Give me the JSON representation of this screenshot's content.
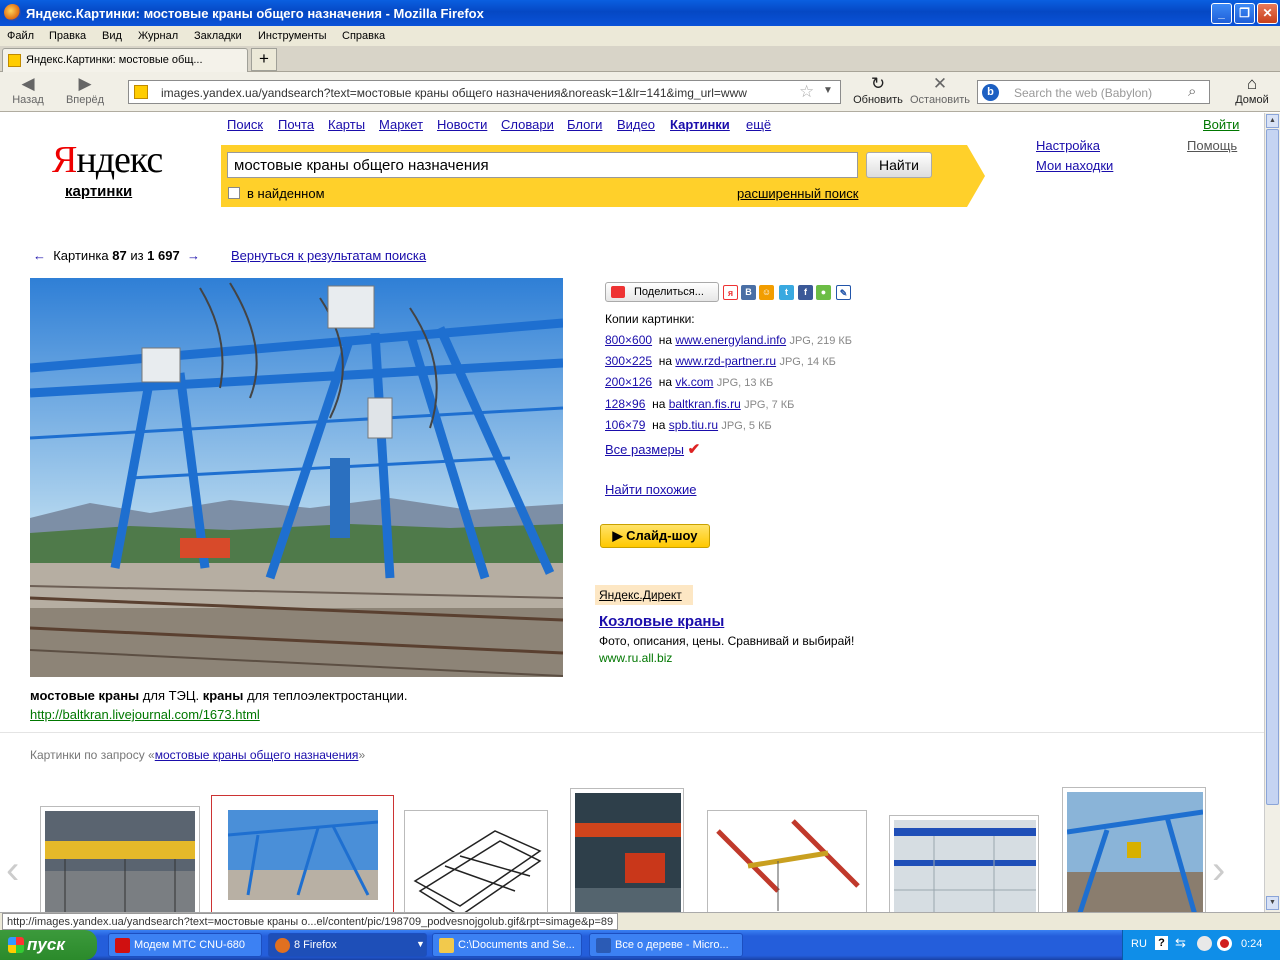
{
  "window": {
    "title": "Яндекс.Картинки: мостовые краны общего назначения - Mozilla Firefox",
    "min_icon": "minimize-icon",
    "max_icon": "maximize-icon",
    "close_icon": "close-icon"
  },
  "menu": [
    "Файл",
    "Правка",
    "Вид",
    "Журнал",
    "Закладки",
    "Инструменты",
    "Справка"
  ],
  "tab": {
    "label": "Яндекс.Картинки: мостовые общ...",
    "new_tab": "+"
  },
  "nav": {
    "back": "Назад",
    "forward": "Вперёд",
    "url": "images.yandex.ua/yandsearch?text=мостовые краны общего назначения&noreask=1&lr=141&img_url=www",
    "reload": "Обновить",
    "stop": "Остановить",
    "search_placeholder": "Search the web (Babylon)",
    "home": "Домой"
  },
  "page": {
    "services": [
      "Поиск",
      "Почта",
      "Карты",
      "Маркет",
      "Новости",
      "Словари",
      "Блоги",
      "Видео",
      "Картинки",
      "ещё"
    ],
    "login": "Войти",
    "settings": "Настройка",
    "help": "Помощь",
    "my_finds": "Мои находки",
    "logo_text": "Яндекс",
    "logo_sub": "картинки",
    "search": {
      "query": "мостовые краны общего назначения",
      "button": "Найти",
      "in_found": "в найденном",
      "advanced": "расширенный поиск"
    },
    "pager": {
      "arrow_left": "←",
      "prefix": "Картинка",
      "current": "87",
      "of": "из",
      "total": "1 697",
      "arrow_right": "→"
    },
    "back_to_results": "Вернуться к результатам поиска",
    "caption": {
      "b1": "мостовые краны",
      "t1": " для ТЭЦ. ",
      "b2": "краны",
      "t2": " для теплоэлектростанции."
    },
    "source_url": "http://baltkran.livejournal.com/1673.html",
    "share": "Поделиться...",
    "copies_title": "Копии картинки:",
    "copies": [
      {
        "size": "800×600",
        "on": "на",
        "site": "www.energyland.info",
        "meta": "JPG, 219 КБ"
      },
      {
        "size": "300×225",
        "on": "на",
        "site": "www.rzd-partner.ru",
        "meta": "JPG, 14 КБ"
      },
      {
        "size": "200×126",
        "on": "на",
        "site": "vk.com",
        "meta": "JPG, 13 КБ"
      },
      {
        "size": "128×96",
        "on": "на",
        "site": "baltkran.fis.ru",
        "meta": "JPG, 7 КБ"
      },
      {
        "size": "106×79",
        "on": "на",
        "site": "spb.tiu.ru",
        "meta": "JPG, 5 КБ"
      }
    ],
    "all_sizes": "Все размеры",
    "find_similar": "Найти похожие",
    "slideshow": "Слайд-шоу",
    "direct": {
      "label": "Яндекс.Директ",
      "title": "Козловые краны",
      "text": "Фото, описания, цены. Сравнивай и выбирай!",
      "url": "www.ru.all.biz"
    },
    "related": {
      "prefix": "Картинки по запросу «",
      "query": "мостовые краны общего назначения",
      "suffix": "»"
    }
  },
  "status_text": "http://images.yandex.ua/yandsearch?text=мостовые краны о...el/content/pic/198709_podvesnojgolub.gif&rpt=simage&p=89",
  "taskbar": {
    "start": "пуск",
    "tasks": [
      "Модем МТС CNU-680",
      "8 Firefox",
      "C:\\Documents and Se...",
      "Все о дереве - Micro..."
    ],
    "lang": "RU",
    "time": "0:24"
  },
  "colors": {
    "yandex_yellow": "#ffd02a",
    "link": "#1a0dab",
    "url_green": "#007700",
    "crane_blue": "#1e6fd0"
  }
}
